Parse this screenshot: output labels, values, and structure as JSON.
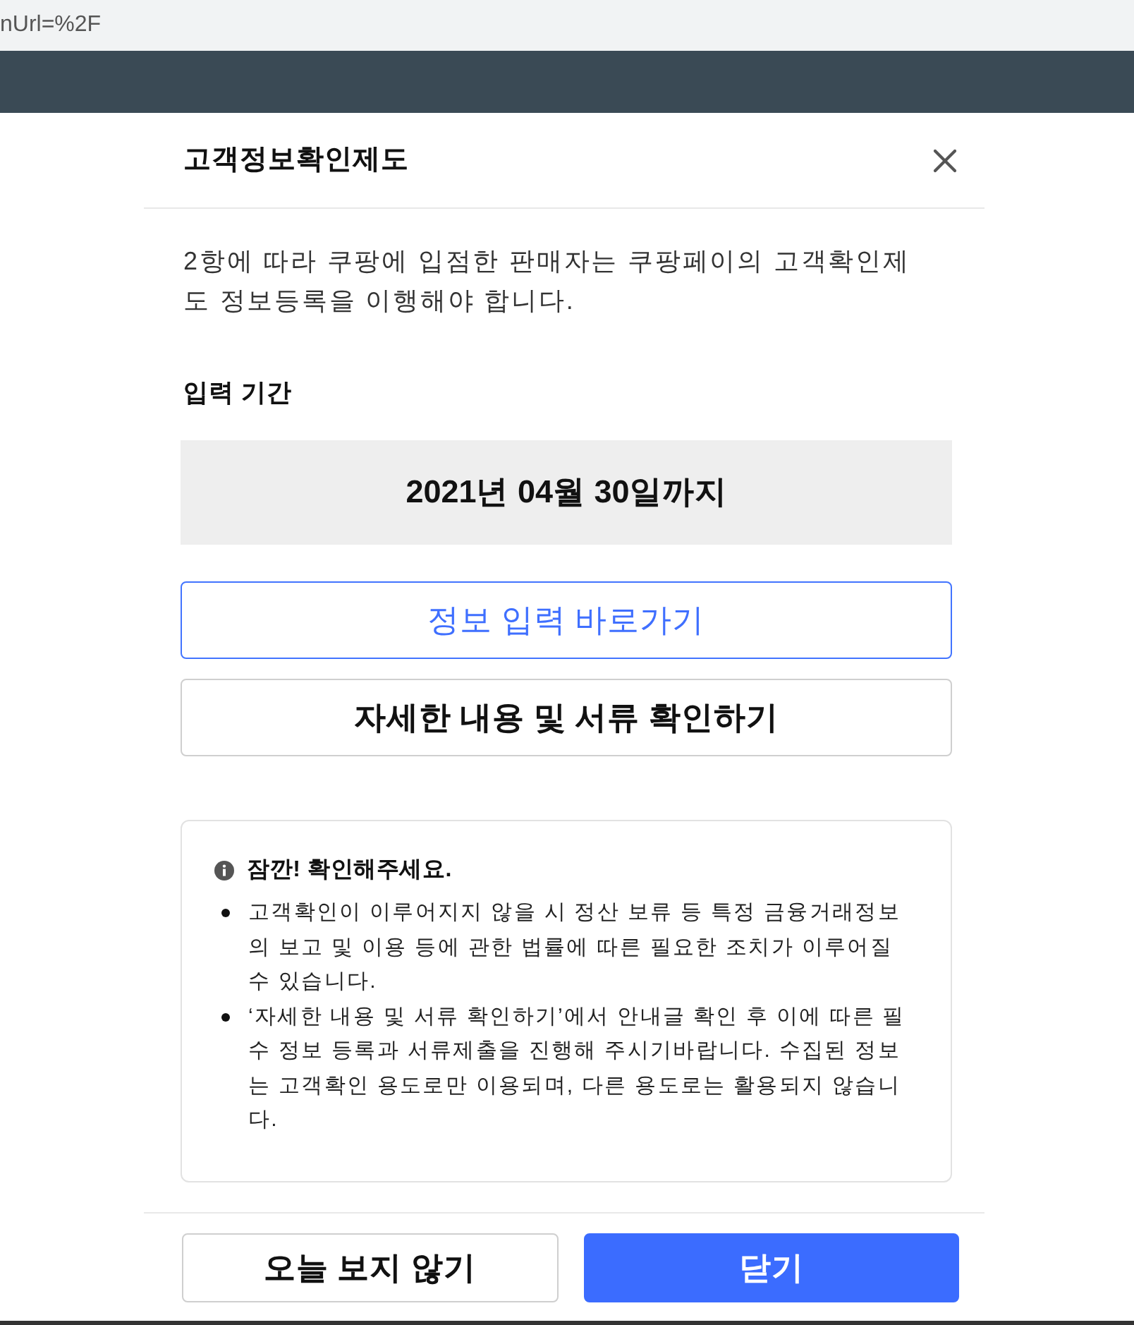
{
  "browser": {
    "address_text": "nUrl=%2F"
  },
  "dialog": {
    "title": "고객정보확인제도",
    "intro": "2항에 따라 쿠팡에 입점한 판매자는 쿠팡페이의 고객확인제도 정보등록을 이행해야 합니다.",
    "period_label": "입력 기간",
    "period_value": "2021년 04월 30일까지",
    "actions": [
      {
        "label": "정보 입력 바로가기",
        "kind": "primary-outline"
      },
      {
        "label": "자세한 내용 및 서류 확인하기",
        "kind": "outline"
      }
    ],
    "notice": {
      "title": "잠깐! 확인해주세요.",
      "items": [
        "고객확인이 이루어지지 않을 시 정산 보류 등 특정 금융거래정보의 보고 및 이용 등에 관한 법률에 따른 필요한 조치가 이루어질 수 있습니다.",
        "‘자세한 내용 및 서류 확인하기’에서 안내글 확인 후 이에 따른 필수 정보 등록과 서류제출을 진행해 주시기바랍니다. 수집된 정보는 고객확인 용도로만 이용되며, 다른 용도로는 활용되지 않습니다."
      ]
    },
    "footer_buttons": [
      {
        "label": "오늘 보지 않기",
        "kind": "outline"
      },
      {
        "label": "닫기",
        "kind": "primary"
      }
    ]
  }
}
